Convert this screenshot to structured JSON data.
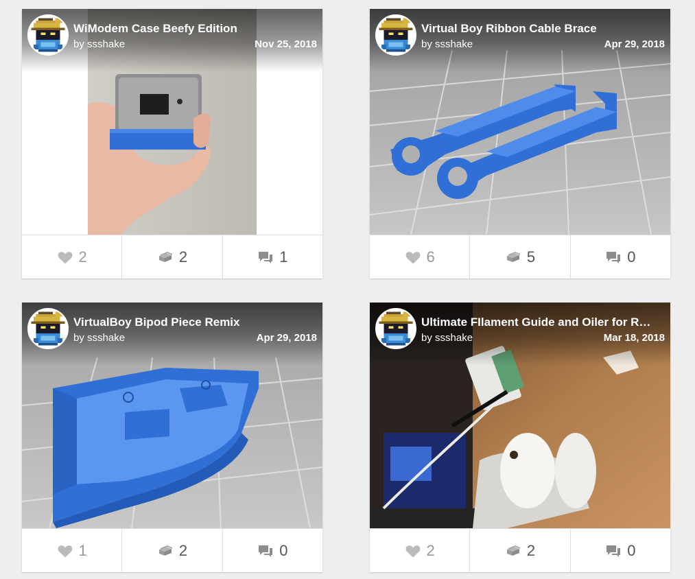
{
  "cards": [
    {
      "title": "WiModem Case Beefy Edition",
      "byline": "by ssshake",
      "date": "Nov 25, 2018",
      "likes": "2",
      "collects": "2",
      "comments": "1"
    },
    {
      "title": "Virtual Boy Ribbon Cable Brace",
      "byline": "by ssshake",
      "date": "Apr 29, 2018",
      "likes": "6",
      "collects": "5",
      "comments": "0"
    },
    {
      "title": "VirtualBoy Bipod Piece Remix",
      "byline": "by ssshake",
      "date": "Apr 29, 2018",
      "likes": "1",
      "collects": "2",
      "comments": "0"
    },
    {
      "title": "Ultimate FIlament Guide and Oiler for R…",
      "byline": "by ssshake",
      "date": "Mar 18, 2018",
      "likes": "2",
      "collects": "2",
      "comments": "0"
    }
  ],
  "icons": {
    "like": "heart-icon",
    "collect": "layers-icon",
    "comment": "speech-bubble-icon"
  },
  "colors": {
    "model_blue": "#2f6fd6",
    "icon_gray": "#999999",
    "count_dark": "#555555"
  }
}
